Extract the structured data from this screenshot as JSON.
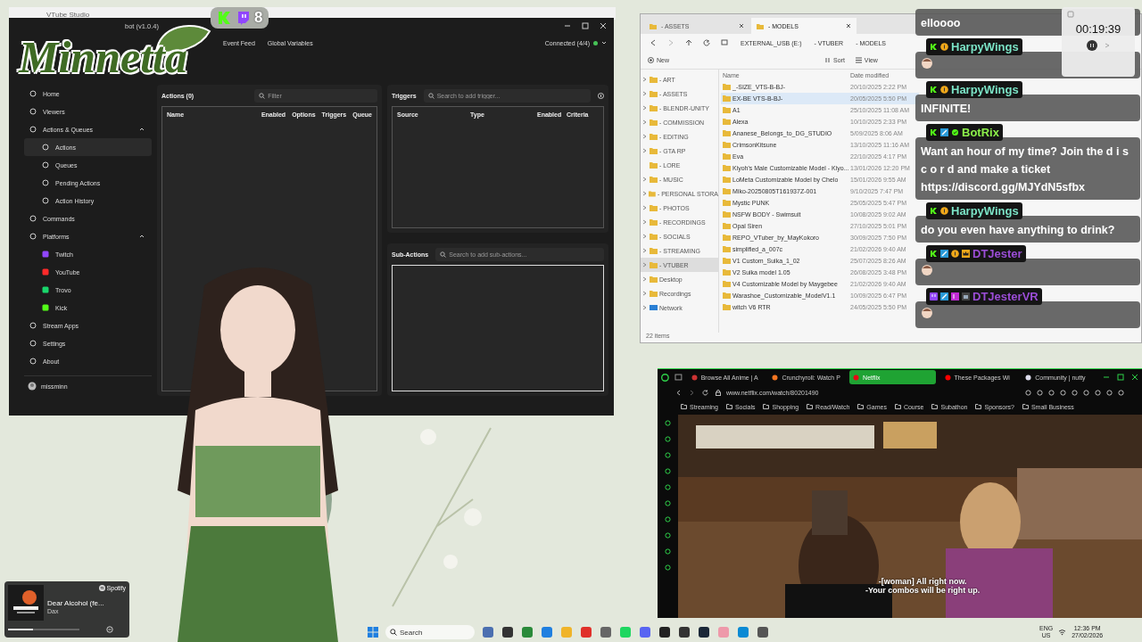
{
  "behind_window": {
    "title": "VTube Studio"
  },
  "logo": {
    "text": "Minnetta"
  },
  "stream_counter": {
    "count": "8"
  },
  "streamerbot": {
    "title": "bot (v1.0.4)",
    "toolbar": [
      "Event Feed",
      "Global Variables"
    ],
    "connection": "Connected (4/4)",
    "connected": true,
    "sidebar": [
      {
        "label": "Home",
        "selected": false
      },
      {
        "label": "Viewers",
        "selected": false
      },
      {
        "label": "Actions & Queues",
        "selected": false,
        "expanded": true,
        "children": [
          {
            "label": "Actions",
            "selected": true
          },
          {
            "label": "Queues",
            "selected": false
          },
          {
            "label": "Pending Actions",
            "selected": false
          },
          {
            "label": "Action History",
            "selected": false
          }
        ]
      },
      {
        "label": "Commands",
        "selected": false
      },
      {
        "label": "Platforms",
        "selected": false,
        "expanded": true,
        "children": [
          {
            "label": "Twitch",
            "selected": false,
            "color": "#9146ff"
          },
          {
            "label": "YouTube",
            "selected": false,
            "color": "#ff2a2a"
          },
          {
            "label": "Trovo",
            "selected": false,
            "color": "#19d66b"
          },
          {
            "label": "Kick",
            "selected": false,
            "color": "#53fc18"
          }
        ]
      },
      {
        "label": "Stream Apps",
        "selected": false
      },
      {
        "label": "Settings",
        "selected": false
      },
      {
        "label": "About",
        "selected": false
      }
    ],
    "user": "missminn",
    "actions": {
      "title": "Actions (0)",
      "placeholder": "Filter",
      "columns": [
        "Name",
        "Enabled",
        "Options",
        "Triggers",
        "Queue"
      ]
    },
    "triggers": {
      "title": "Triggers",
      "placeholder": "Search to add trigger...",
      "columns": [
        "Source",
        "Type",
        "Enabled",
        "Criteria"
      ]
    },
    "sub_actions": {
      "title": "Sub-Actions",
      "placeholder": "Search to add sub-actions..."
    }
  },
  "explorer": {
    "tabs": [
      {
        "label": "- ASSETS",
        "selected": false
      },
      {
        "label": "- MODELS",
        "selected": true
      }
    ],
    "breadcrumb": [
      "EXTERNAL_USB (E:)",
      "- VTUBER",
      "- MODELS"
    ],
    "toolbar": {
      "new": "New",
      "sort": "Sort",
      "view": "View"
    },
    "tree": [
      {
        "label": "- ART",
        "selected": false,
        "expandable": true,
        "kind": "folder"
      },
      {
        "label": "- ASSETS",
        "selected": false,
        "expandable": true,
        "kind": "folder"
      },
      {
        "label": "- BLENDR-UNITY",
        "selected": false,
        "expandable": true,
        "kind": "folder"
      },
      {
        "label": "- COMMISSION",
        "selected": false,
        "expandable": true,
        "kind": "folder"
      },
      {
        "label": "- EDITING",
        "selected": false,
        "expandable": true,
        "kind": "folder"
      },
      {
        "label": "- GTA RP",
        "selected": false,
        "expandable": true,
        "kind": "folder"
      },
      {
        "label": "- LORE",
        "selected": false,
        "expandable": false,
        "kind": "folder"
      },
      {
        "label": "- MUSIC",
        "selected": false,
        "expandable": true,
        "kind": "folder"
      },
      {
        "label": "- PERSONAL STORA",
        "selected": false,
        "expandable": true,
        "kind": "folder"
      },
      {
        "label": "- PHOTOS",
        "selected": false,
        "expandable": true,
        "kind": "folder"
      },
      {
        "label": "- RECORDINGS",
        "selected": false,
        "expandable": true,
        "kind": "folder"
      },
      {
        "label": "- SOCIALS",
        "selected": false,
        "expandable": true,
        "kind": "folder"
      },
      {
        "label": "- STREAMING",
        "selected": false,
        "expandable": true,
        "kind": "folder"
      },
      {
        "label": "- VTUBER",
        "selected": true,
        "expandable": true,
        "kind": "folder"
      },
      {
        "label": "Desktop",
        "selected": false,
        "expandable": true,
        "kind": "folder"
      },
      {
        "label": "Recordings",
        "selected": false,
        "expandable": true,
        "kind": "folder"
      },
      {
        "label": "Network",
        "selected": false,
        "expandable": true,
        "kind": "network"
      }
    ],
    "columns": [
      "Name",
      "Date modified"
    ],
    "files": [
      {
        "name": "_-SIZE_VTS-B-BJ-",
        "date": "20/10/2025 2:22 PM",
        "selected": false
      },
      {
        "name": "EX-BE VTS-B-BJ-",
        "date": "20/05/2025 5:50 PM",
        "selected": true
      },
      {
        "name": "A1",
        "date": "25/10/2025 11:08 AM",
        "selected": false
      },
      {
        "name": "Alexa",
        "date": "10/10/2025 2:33 PM",
        "selected": false
      },
      {
        "name": "Ananese_Belongs_to_DG_STUDIO",
        "date": "5/09/2025 8:06 AM",
        "selected": false
      },
      {
        "name": "CrimsonKitsune",
        "date": "13/10/2025 11:16 AM",
        "selected": false
      },
      {
        "name": "Eva",
        "date": "22/10/2025 4:17 PM",
        "selected": false
      },
      {
        "name": "Kiyoh's Male Customizable Model - Kiyo...",
        "date": "13/01/2026 12:20 PM",
        "selected": false
      },
      {
        "name": "LoMeta Customizable Model by Chelo",
        "date": "15/01/2026 9:55 AM",
        "selected": false
      },
      {
        "name": "Miko-20250805T161937Z-001",
        "date": "9/10/2025 7:47 PM",
        "selected": false
      },
      {
        "name": "Mystic PUNK",
        "date": "25/05/2025 5:47 PM",
        "selected": false
      },
      {
        "name": "NSFW BODY - Swimsuit",
        "date": "10/08/2025 9:02 AM",
        "selected": false
      },
      {
        "name": "Opal Siren",
        "date": "27/10/2025 5:01 PM",
        "selected": false
      },
      {
        "name": "REPO_VTuber_by_MayKokoro",
        "date": "30/09/2025 7:50 PM",
        "selected": false
      },
      {
        "name": "simplified_a_007c",
        "date": "21/02/2026 9:40 AM",
        "selected": false
      },
      {
        "name": "V1 Custom_Suika_1_02",
        "date": "25/07/2025 8:26 AM",
        "selected": false
      },
      {
        "name": "V2 Suika model 1.05",
        "date": "26/08/2025 3:48 PM",
        "selected": false
      },
      {
        "name": "V4 Customizable Model by Maygebee",
        "date": "21/02/2026 9:40 AM",
        "selected": false
      },
      {
        "name": "Warashoe_Customizable_ModelV1.1",
        "date": "10/09/2025 6:47 PM",
        "selected": false
      },
      {
        "name": "witch V6 RTR",
        "date": "24/05/2025 5:50 PM",
        "selected": false
      }
    ],
    "status": "22 items"
  },
  "timer": {
    "time": "00:19:39"
  },
  "chat": {
    "messages": [
      {
        "kind": "text",
        "text": "elloooo"
      },
      {
        "kind": "emote",
        "user": "HarpyWings",
        "color": "#7be3c6",
        "badges": [
          {
            "kind": "kick"
          },
          {
            "kind": "sub"
          }
        ]
      },
      {
        "kind": "text",
        "user": "HarpyWings",
        "color": "#7be3c6",
        "badges": [
          {
            "kind": "kick"
          },
          {
            "kind": "sub"
          }
        ],
        "text": "INFINITE!"
      },
      {
        "kind": "text",
        "user": "BotRix",
        "color": "#8cf04a",
        "badges": [
          {
            "kind": "kick"
          },
          {
            "kind": "mod"
          },
          {
            "kind": "verified"
          }
        ],
        "text": "Want an hour of my time? Join the d i s c o r d and make a ticket https://discord.gg/MJYdN5sfbx"
      },
      {
        "kind": "text",
        "user": "HarpyWings",
        "color": "#7be3c6",
        "badges": [
          {
            "kind": "kick"
          },
          {
            "kind": "sub"
          }
        ],
        "text": "do you even have anything to drink?"
      },
      {
        "kind": "emote",
        "user": "DTJester",
        "color": "#9b4dd6",
        "badges": [
          {
            "kind": "kick"
          },
          {
            "kind": "mod"
          },
          {
            "kind": "sub"
          },
          {
            "kind": "crown"
          }
        ]
      },
      {
        "kind": "emote",
        "user": "DTJesterVR",
        "color": "#9b4dd6",
        "badges": [
          {
            "kind": "twitch"
          },
          {
            "kind": "mod"
          },
          {
            "kind": "tier"
          },
          {
            "kind": "gift"
          }
        ]
      }
    ]
  },
  "browser": {
    "tabs": [
      {
        "label": "Browse All Anime | A",
        "selected": false
      },
      {
        "label": "Crunchyroll: Watch P",
        "selected": false
      },
      {
        "label": "Netflix",
        "selected": true
      },
      {
        "label": "These Packages Wi",
        "selected": false
      },
      {
        "label": "Community | nutty",
        "selected": false
      }
    ],
    "url": "www.netflix.com/watch/80201490",
    "bookmarks": [
      "Streaming",
      "Socials",
      "Shopping",
      "Read/Watch",
      "Games",
      "Course",
      "Subathon",
      "Sponsors?",
      "Small Business"
    ],
    "subtitles": [
      "-[woman] All right now.",
      "-Your combos will be right up."
    ]
  },
  "spotify": {
    "app": "Spotify",
    "track": "Dear Alcohol (fe...",
    "artist": "Dax",
    "level": 0.35
  },
  "taskbar": {
    "placeholder": "Search",
    "language": "ENG",
    "region": "US",
    "time": "12:36 PM",
    "date": "27/02/2026"
  }
}
